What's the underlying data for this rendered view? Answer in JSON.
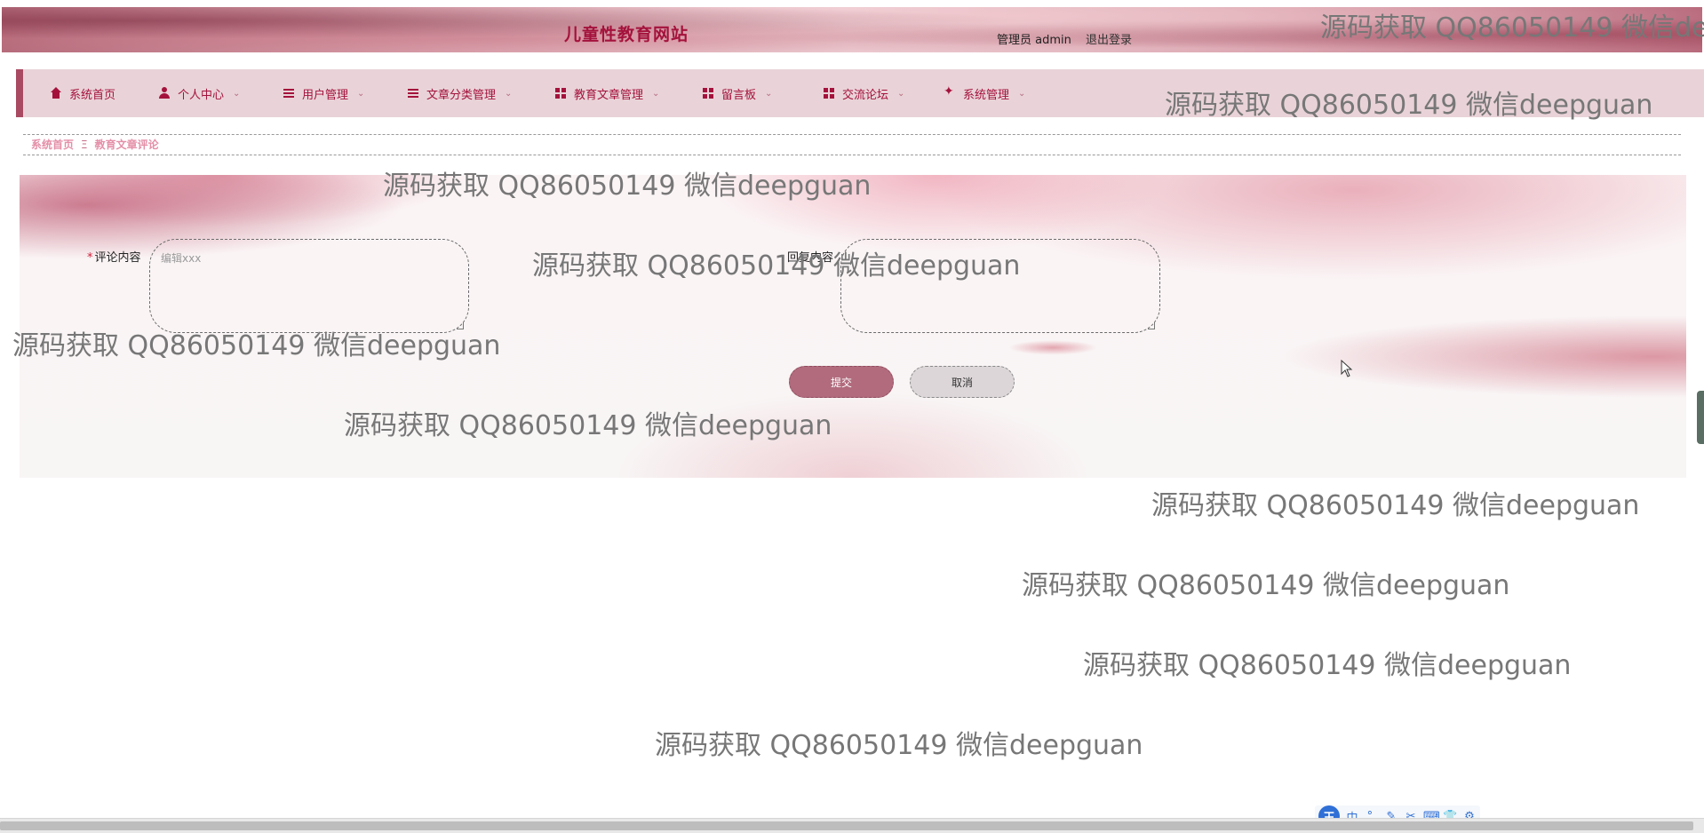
{
  "header": {
    "site_title": "儿童性教育网站",
    "user_label": "管理员 admin",
    "logout_label": "退出登录"
  },
  "nav": {
    "items": [
      {
        "label": "系统首页",
        "icon": "home-icon",
        "has_dropdown": false
      },
      {
        "label": "个人中心",
        "icon": "user-icon",
        "has_dropdown": true
      },
      {
        "label": "用户管理",
        "icon": "list-icon",
        "has_dropdown": true
      },
      {
        "label": "文章分类管理",
        "icon": "list-icon",
        "has_dropdown": true
      },
      {
        "label": "教育文章管理",
        "icon": "grid-icon",
        "has_dropdown": true
      },
      {
        "label": "留言板",
        "icon": "grid-icon",
        "has_dropdown": true
      },
      {
        "label": "交流论坛",
        "icon": "grid-icon",
        "has_dropdown": true
      },
      {
        "label": "系统管理",
        "icon": "gear-icon",
        "has_dropdown": true
      }
    ],
    "chevron": "⌄"
  },
  "breadcrumb": {
    "home": "系统首页",
    "separator": "Ξ",
    "current": "教育文章评论"
  },
  "form": {
    "comment": {
      "label": "评论内容",
      "required_mark": "*",
      "placeholder": "编辑xxx",
      "value": ""
    },
    "reply": {
      "label": "回复内容",
      "value": ""
    },
    "submit_label": "提交",
    "cancel_label": "取消"
  },
  "watermark": {
    "text": "源码获取 QQ86050149 微信deepguan"
  },
  "ime_toolbar": {
    "logo": "王",
    "tools": [
      "中",
      "°,",
      "✎",
      "✂",
      "⌨",
      "👕",
      "⚙"
    ]
  },
  "colors": {
    "accent": "#a4123c",
    "nav_bg": "#e9d3d8",
    "breadcrumb": "#e48fa8",
    "submit_bg": "#b16b7d",
    "cancel_bg": "#dcd6d8"
  }
}
